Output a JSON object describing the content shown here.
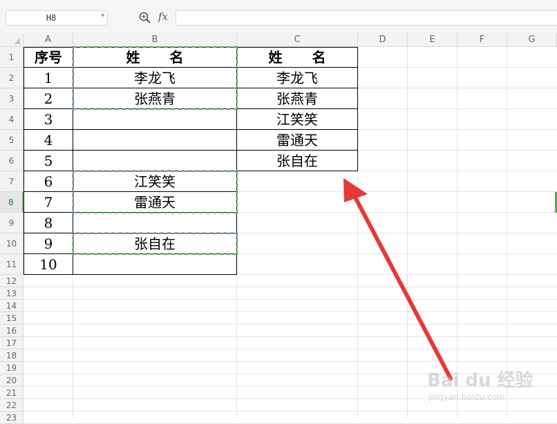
{
  "formula_bar": {
    "name_box": "H8",
    "fx_label": "fx",
    "formula": ""
  },
  "columns": [
    "A",
    "B",
    "C",
    "D",
    "E",
    "F",
    "G"
  ],
  "rows": [
    "1",
    "2",
    "3",
    "4",
    "5",
    "6",
    "7",
    "8",
    "9",
    "10",
    "11",
    "12",
    "13",
    "14",
    "15",
    "16",
    "17",
    "18",
    "19",
    "20",
    "21",
    "22",
    "23"
  ],
  "active_row": "8",
  "table_left": {
    "header_a": "序号",
    "header_b": "姓 名",
    "numbers": [
      "1",
      "2",
      "3",
      "4",
      "5",
      "6",
      "7",
      "8",
      "9",
      "10"
    ],
    "names": [
      "李龙飞",
      "张燕青",
      "",
      "",
      "",
      "江笑笑",
      "雷通天",
      "",
      "张自在",
      ""
    ]
  },
  "table_right": {
    "header": "姓 名",
    "names": [
      "李龙飞",
      "张燕青",
      "江笑笑",
      "雷通天",
      "张自在"
    ]
  },
  "watermark": {
    "brand": "Bai du 经验",
    "url": "jingyan.baidu.com"
  },
  "colors": {
    "selection_dash": "#52a152",
    "arrow": "#e53935",
    "active_row_header": "#2e7d32"
  }
}
